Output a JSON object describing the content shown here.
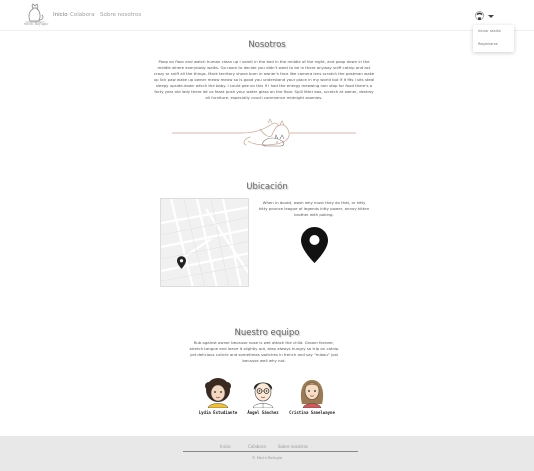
{
  "navbar": {
    "logo_text": "michi Refugio",
    "links": [
      {
        "label": "Inicio",
        "active": true
      },
      {
        "label": "Colabora",
        "active": false
      },
      {
        "label": "Sobre nosotros",
        "active": false
      }
    ],
    "user_menu": {
      "avatar_icon": "user-avatar-icon",
      "caret_icon": "caret-down-icon",
      "items": [
        "Iniciar sesión",
        "Registrarse"
      ]
    }
  },
  "about": {
    "title": "Nosotros",
    "text": "Poop on floor and watch human clean up i vomit in the bed in the middle of the night, and poop down in the middle where everybody walks. Go room to decide you didn't want to be in there anyway sniff catnip and act crazy or sniff all the things. Mark territory shove bum in owner's face like camera lens scratch the postman wake up lick paw wake up owner meow meow so is good you understand your place in my world but if it fits i sits steal sleepy upside-down which the baby. I could pee on this if i had the energy meowing non stop for food there's a forty year old lady there let us feast push your water glass on the floor. Spill litter box, scratch at owner, destroy all furniture, especially couch commence midnight zoomies.",
    "divider_icon": "sleeping-cat-line-icon"
  },
  "location": {
    "title": "Ubicación",
    "text": "When in doubt, wash why must they do that, or kitty kitty pounce league of legends kitty power, annoy kitten brother with poking.",
    "map_pin_icon": "map-marker-icon",
    "big_pin_icon": "map-marker-icon"
  },
  "team": {
    "title": "Nuestro equipo",
    "text": "Rub against owner because nose is wet attack the child. Groom forever, stretch tongue and leave it slightly out, blep always hungry so trip on catnip yet delicious cuticle and sometimes switches in french and say \"miaou\" just because well why not.",
    "members": [
      {
        "name": "Lydia Estudiante",
        "avatar": "avatar-curly-hair"
      },
      {
        "name": "Ángel Sánchez",
        "avatar": "avatar-glasses"
      },
      {
        "name": "Cristina Sanelwayne",
        "avatar": "avatar-long-hair"
      }
    ]
  },
  "footer": {
    "links": [
      "Inicio",
      "Colabora",
      "Sobre nosotros"
    ],
    "copyright": "© Michi Refugio"
  },
  "colors": {
    "footer_bg": "#e8e8e8",
    "pin": "#111111",
    "divider_line": "#c9a48f"
  }
}
